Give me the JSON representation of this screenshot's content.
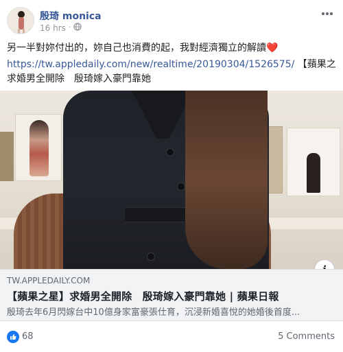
{
  "post": {
    "author": "殷琦 monica",
    "time": "16 hrs",
    "separator": "·",
    "privacy_icon": "globe-icon",
    "more_icon": "more-options-icon",
    "message_line1": "另一半對妳付出的，妳自己也消費的起，我對經濟獨立的解讀",
    "heart": "❤️",
    "link_text": "https://tw.appledaily.com/new/realtime/20190304/1526575/",
    "link_suffix": "【蘋果之星】",
    "message_line3": "求婚男全開除　殷琦嫁入豪門靠她"
  },
  "link_preview": {
    "domain": "TW.APPLEDAILY.COM",
    "headline": "【蘋果之星】求婚男全開除　殷琦嫁入豪門靠她 | 蘋果日報",
    "description": "殷琦去年6月閃嫁台中10億身家富豪張仕育，沉浸新婚喜悅的她婚後首度...",
    "info_label": "i"
  },
  "footer": {
    "likes": "68",
    "comments": "5 Comments"
  },
  "colors": {
    "link": "#385898",
    "like_blue": "#1877f2"
  }
}
